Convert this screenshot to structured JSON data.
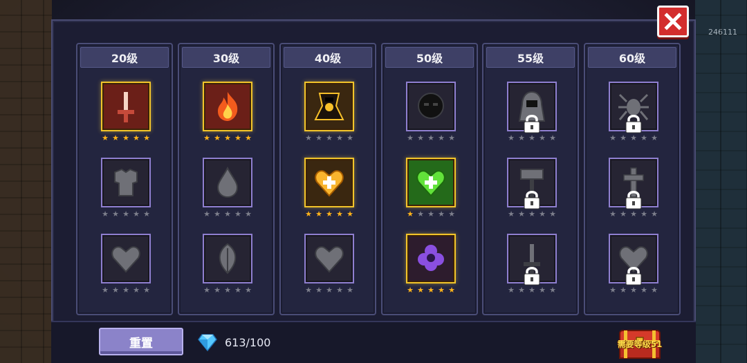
{
  "player": {
    "id_fragment": "246111"
  },
  "close": {
    "icon": "close-x-icon"
  },
  "tiers": [
    {
      "level": "20级",
      "slots": [
        {
          "icon": "sword-icon",
          "state": "active",
          "stars": 5
        },
        {
          "icon": "armor-icon",
          "state": "inactive",
          "stars": 0
        },
        {
          "icon": "heart-icon",
          "state": "inactive",
          "stars": 0
        }
      ]
    },
    {
      "level": "30级",
      "slots": [
        {
          "icon": "flame-icon",
          "state": "active",
          "stars": 5
        },
        {
          "icon": "water-drop-icon",
          "state": "inactive",
          "stars": 0
        },
        {
          "icon": "leaf-icon",
          "state": "inactive",
          "stars": 0
        }
      ]
    },
    {
      "level": "40级",
      "slots": [
        {
          "icon": "dark-cloak-icon",
          "state": "active",
          "stars": 0
        },
        {
          "icon": "heart-plus-icon",
          "state": "active",
          "stars": 5
        },
        {
          "icon": "heart-icon",
          "state": "inactive",
          "stars": 0
        }
      ]
    },
    {
      "level": "50级",
      "slots": [
        {
          "icon": "shadow-face-icon",
          "state": "inactive",
          "stars": 0
        },
        {
          "icon": "heart-plus-icon",
          "state": "active",
          "stars": 1
        },
        {
          "icon": "purple-flower-icon",
          "state": "active",
          "stars": 5
        }
      ]
    },
    {
      "level": "55级",
      "slots": [
        {
          "icon": "hooded-figure-icon",
          "state": "locked",
          "stars": 0
        },
        {
          "icon": "hammer-icon",
          "state": "locked",
          "stars": 0
        },
        {
          "icon": "sword-icon",
          "state": "locked",
          "stars": 0
        }
      ]
    },
    {
      "level": "60级",
      "slots": [
        {
          "icon": "spider-icon",
          "state": "locked",
          "stars": 0
        },
        {
          "icon": "cross-icon",
          "state": "locked",
          "stars": 0
        },
        {
          "icon": "heart-icon",
          "state": "locked",
          "stars": 0
        }
      ]
    }
  ],
  "footer": {
    "reset_label": "重置",
    "gem_icon": "diamond-gem-icon",
    "gem_count": "613/100",
    "chest_icon": "treasure-chest-icon",
    "chest_label": "需要等级51"
  },
  "colors": {
    "gold": "#f3c52a",
    "star_on": "#ffb31a",
    "star_off": "#7d7f8c",
    "close_red": "#d32d2d",
    "lock_frame": "#8f7fd0"
  }
}
